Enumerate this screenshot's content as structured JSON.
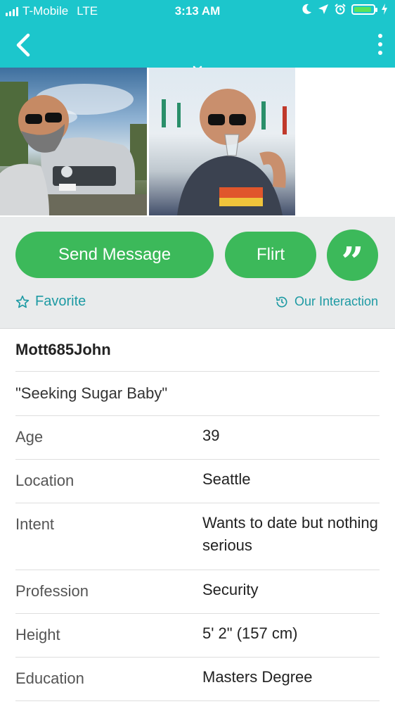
{
  "status_bar": {
    "carrier": "T-Mobile",
    "network": "LTE",
    "time": "3:13 AM"
  },
  "actions": {
    "send_message": "Send Message",
    "flirt": "Flirt",
    "quote_glyph": "”",
    "favorite": "Favorite",
    "our_interaction": "Our Interaction"
  },
  "profile": {
    "username": "Mott685John",
    "headline": "\"Seeking Sugar Baby\"",
    "fields": [
      {
        "label": "Age",
        "value": "39"
      },
      {
        "label": "Location",
        "value": "Seattle"
      },
      {
        "label": "Intent",
        "value": "Wants to date but nothing serious"
      },
      {
        "label": "Profession",
        "value": "Security"
      },
      {
        "label": "Height",
        "value": "5' 2\" (157 cm)"
      },
      {
        "label": "Education",
        "value": "Masters Degree"
      }
    ]
  },
  "colors": {
    "header": "#1cc6cc",
    "button": "#3cb95a",
    "link": "#1d9aa3"
  }
}
